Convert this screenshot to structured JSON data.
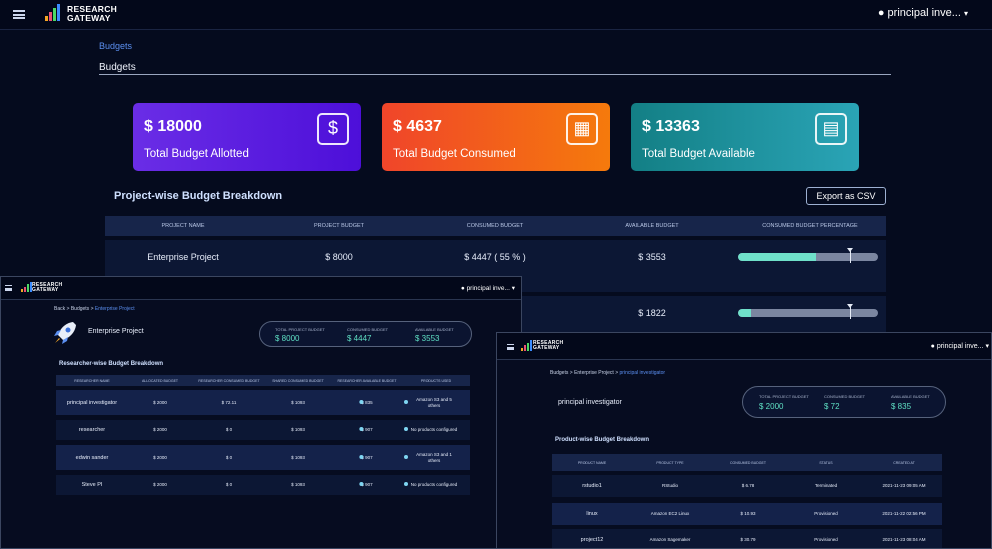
{
  "header": {
    "brand_line1": "RESEARCH",
    "brand_line2": "GATEWAY",
    "user_label": "principal inve..."
  },
  "breadcrumb": {
    "link": "Budgets"
  },
  "page_title": "Budgets",
  "cards": [
    {
      "amount": "$ 18000",
      "label": "Total Budget Allotted",
      "icon": "money-bag-icon",
      "gradient": [
        "#6a2de6",
        "#4d0fd9"
      ]
    },
    {
      "amount": "$ 4637",
      "label": "Total Budget Consumed",
      "icon": "cash-register-icon",
      "gradient": [
        "#f0452a",
        "#f57a0c"
      ]
    },
    {
      "amount": "$ 13363",
      "label": "Total Budget Available",
      "icon": "wallet-icon",
      "gradient": [
        "#137f85",
        "#2aa4b6"
      ]
    }
  ],
  "project_section": {
    "title": "Project-wise Budget Breakdown",
    "export_label": "Export as CSV",
    "columns": [
      "PROJECT NAME",
      "PROJECT BUDGET",
      "CONSUMED BUDGET",
      "AVAILABLE BUDGET",
      "CONSUMED BUDGET PERCENTAGE"
    ],
    "rows": [
      {
        "name": "Enterprise Project",
        "budget": "$ 8000",
        "consumed": "$ 4447 ( 55 % )",
        "available": "$ 3553",
        "consumed_fraction": 0.56,
        "threshold_fraction": 0.8
      },
      {
        "name": "",
        "budget": "",
        "consumed": "",
        "available": "$ 1822",
        "consumed_fraction": 0.09,
        "threshold_fraction": 0.8
      }
    ]
  },
  "win1": {
    "brand_line1": "RESEARCH",
    "brand_line2": "GATEWAY",
    "user_label": "principal inve...",
    "crumb_back": "Back",
    "crumb_sep1": ">",
    "crumb_budgets": "Budgets",
    "crumb_sep2": ">",
    "crumb_current": "Enterprise Project",
    "project_name": "Enterprise Project",
    "summary": [
      {
        "k": "TOTAL PROJECT BUDGET",
        "v": "$ 8000"
      },
      {
        "k": "CONSUMED BUDGET",
        "v": "$ 4447"
      },
      {
        "k": "AVAILABLE BUDGET",
        "v": "$ 3553"
      }
    ],
    "section_title": "Researcher-wise Budget Breakdown",
    "columns": [
      "RESEARCHER NAME",
      "ALLOCATED BUDGET",
      "RESEARCHER CONSUMED BUDGET",
      "SHARED CONSUMED BUDGET",
      "RESEARCHER AVAILABLE BUDGET",
      "PRODUCTS USED"
    ],
    "rows": [
      {
        "name": "principal investigator",
        "allocated": "$ 2000",
        "consumed": "$ 72.11",
        "shared": "$ 1093",
        "available": "$ 835",
        "products": [
          "Amazon S3 and 5",
          "others"
        ]
      },
      {
        "name": "researcher",
        "allocated": "$ 2000",
        "consumed": "$ 0",
        "shared": "$ 1093",
        "available": "$ 907",
        "products": [
          "No products configured"
        ]
      },
      {
        "name": "edwin sander",
        "allocated": "$ 2000",
        "consumed": "$ 0",
        "shared": "$ 1093",
        "available": "$ 907",
        "products": [
          "Amazon S3 and 1",
          "others"
        ]
      },
      {
        "name": "Steve PI",
        "allocated": "$ 2000",
        "consumed": "$ 0",
        "shared": "$ 1093",
        "available": "$ 907",
        "products": [
          "No products configured"
        ]
      }
    ]
  },
  "win2": {
    "user_label": "principal inve...",
    "crumb_budgets": "Budgets",
    "crumb_sep1": ">",
    "crumb_project": "Enterprise Project",
    "crumb_sep2": ">",
    "crumb_current": "principal investigator",
    "researcher_name": "principal investigator",
    "summary": [
      {
        "k": "TOTAL PROJECT BUDGET",
        "v": "$ 2000"
      },
      {
        "k": "CONSUMED BUDGET",
        "v": "$ 72"
      },
      {
        "k": "AVAILABLE BUDGET",
        "v": "$ 835"
      }
    ],
    "section_title": "Product-wise Budget Breakdown",
    "columns": [
      "PRODUCT NAME",
      "PRODUCT TYPE",
      "CONSUMED BUDGET",
      "STATUS",
      "CREATED AT"
    ],
    "rows": [
      {
        "name": "rstudio1",
        "type": "RStudio",
        "consumed": "$ 6.78",
        "status": "Terminated",
        "created": "2021-11-23 09:05 AM"
      },
      {
        "name": "linux",
        "type": "Amazon EC2 Linux",
        "consumed": "$ 10.93",
        "status": "Provisioned",
        "created": "2021-11-22 02:56 PM"
      },
      {
        "name": "project12",
        "type": "Amazon Sagemaker",
        "consumed": "$ 30.79",
        "status": "Provisioned",
        "created": "2021-11-23 08:04 AM"
      }
    ]
  }
}
